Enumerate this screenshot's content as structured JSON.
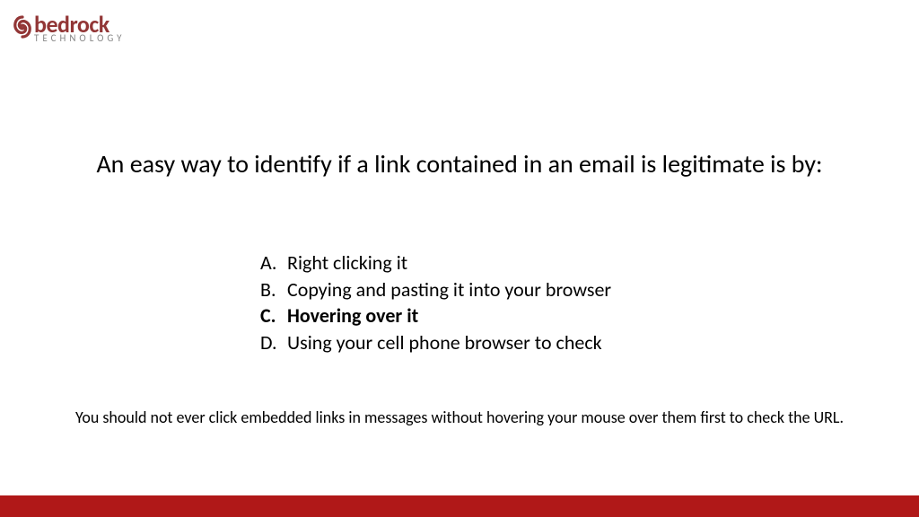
{
  "logo": {
    "main": "bedrock",
    "sub": "TECHNOLOGY"
  },
  "question": "An easy way to identify if a link contained in an email is legitimate is by:",
  "options": [
    {
      "letter": "A.",
      "text": "Right clicking it",
      "correct": false
    },
    {
      "letter": "B.",
      "text": "Copying and pasting it into your browser",
      "correct": false
    },
    {
      "letter": "C.",
      "text": "Hovering over it",
      "correct": true
    },
    {
      "letter": "D.",
      "text": "Using your cell phone browser to check",
      "correct": false
    }
  ],
  "explanation": "You should not ever click embedded links in messages without hovering your mouse over them first to check the URL."
}
